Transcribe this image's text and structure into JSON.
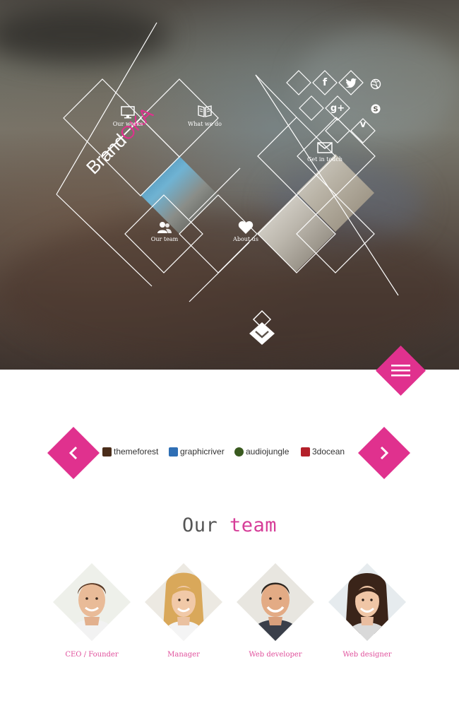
{
  "brand": {
    "name_part1": "Brand",
    "name_part2": "OKA"
  },
  "tiles": {
    "our_works": "Our works",
    "what_we_do": "What we do",
    "our_team": "Our team",
    "about_us": "About us",
    "get_in_touch": "Get in touch"
  },
  "social": [
    "facebook-icon",
    "twitter-icon",
    "dribbble-icon",
    "google-plus-icon",
    "skype-icon",
    "vimeo-icon"
  ],
  "logos": [
    {
      "name": "themeforest",
      "color": "#4a2d1a"
    },
    {
      "name": "graphicriver",
      "color": "#2f6fb5"
    },
    {
      "name": "audiojungle",
      "color": "#3a5a1f"
    },
    {
      "name": "3docean",
      "color": "#b4202a"
    }
  ],
  "team": {
    "title_part1": "Our",
    "title_part2": "team",
    "members": [
      {
        "role": "CEO / Founder"
      },
      {
        "role": "Manager"
      },
      {
        "role": "Web developer"
      },
      {
        "role": "Web designer"
      }
    ]
  },
  "colors": {
    "accent": "#e0318e",
    "white": "#ffffff"
  }
}
